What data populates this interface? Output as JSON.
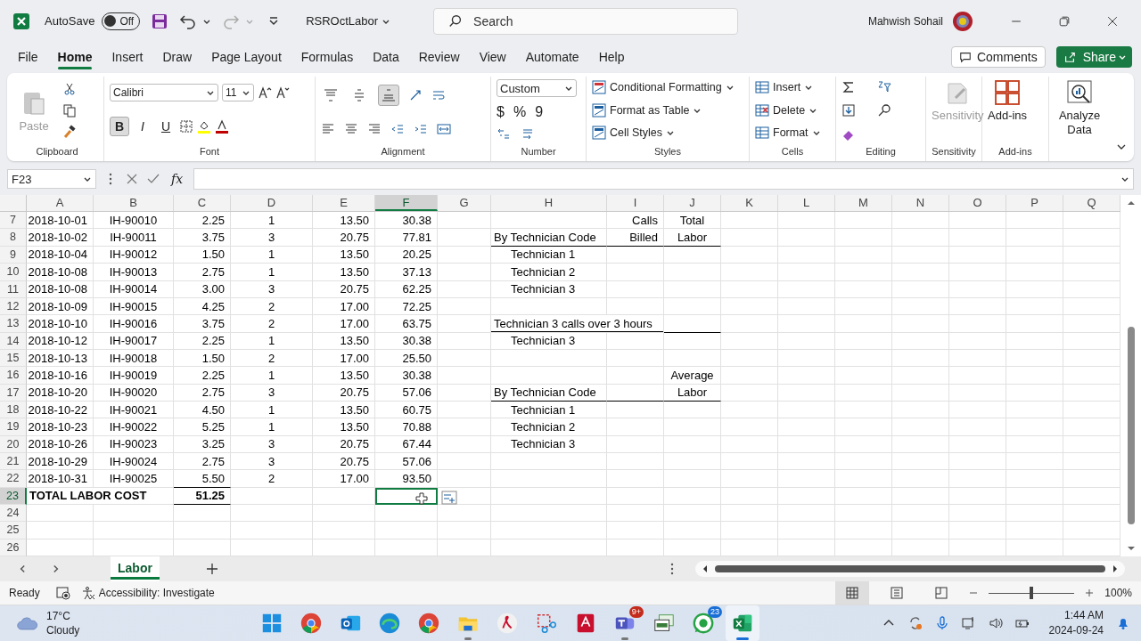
{
  "title_bar": {
    "autosave_label": "AutoSave",
    "autosave": {
      "label": "Off",
      "on": false
    },
    "file_name": "RSROctLabor",
    "search_placeholder": "Search",
    "user_name": "Mahwish Sohail"
  },
  "menu_tabs": [
    {
      "label": "File",
      "selected": false
    },
    {
      "label": "Home",
      "selected": true
    },
    {
      "label": "Insert",
      "selected": false
    },
    {
      "label": "Draw",
      "selected": false
    },
    {
      "label": "Page Layout",
      "selected": false
    },
    {
      "label": "Formulas",
      "selected": false
    },
    {
      "label": "Data",
      "selected": false
    },
    {
      "label": "Review",
      "selected": false
    },
    {
      "label": "View",
      "selected": false
    },
    {
      "label": "Automate",
      "selected": false
    },
    {
      "label": "Help",
      "selected": false
    }
  ],
  "comments_button": "Comments",
  "share_button": "Share",
  "ribbon": {
    "clipboard": {
      "paste": "Paste",
      "paste_disabled": true,
      "label": "Clipboard"
    },
    "font": {
      "name": "Calibri",
      "size": "11",
      "label": "Font",
      "styles": [
        {
          "label": "B",
          "selected": true
        },
        {
          "label": "I",
          "selected": false
        },
        {
          "label": "U",
          "selected": false
        }
      ]
    },
    "alignment": {
      "label": "Alignment",
      "vertical": [
        {
          "selected": false
        },
        {
          "selected": false
        },
        {
          "selected": true
        }
      ]
    },
    "number": {
      "format": "Custom",
      "symbols": [
        "$",
        "%",
        "9"
      ],
      "label": "Number"
    },
    "styles": {
      "commands": [
        "Conditional Formatting",
        "Format as Table",
        "Cell Styles"
      ],
      "label": "Styles"
    },
    "cells": {
      "commands": [
        "Insert",
        "Delete",
        "Format"
      ],
      "label": "Cells"
    },
    "editing": {
      "label": "Editing"
    },
    "sensitivity": {
      "button": "Sensitivity",
      "disabled": true,
      "label": "Sensitivity"
    },
    "addins": {
      "button": "Add-ins",
      "label": "Add-ins"
    },
    "analyze": {
      "button": "Analyze Data"
    }
  },
  "formula_bar": {
    "name_box": "F23",
    "function_label": "fx"
  },
  "sheet": {
    "columns": [
      {
        "letter": "A",
        "selected": false
      },
      {
        "letter": "B",
        "selected": false
      },
      {
        "letter": "C",
        "selected": false
      },
      {
        "letter": "D",
        "selected": false
      },
      {
        "letter": "E",
        "selected": false
      },
      {
        "letter": "F",
        "selected": true
      },
      {
        "letter": "G",
        "selected": false
      },
      {
        "letter": "H",
        "selected": false
      },
      {
        "letter": "I",
        "selected": false
      },
      {
        "letter": "J",
        "selected": false
      },
      {
        "letter": "K",
        "selected": false
      },
      {
        "letter": "L",
        "selected": false
      },
      {
        "letter": "M",
        "selected": false
      },
      {
        "letter": "N",
        "selected": false
      },
      {
        "letter": "O",
        "selected": false
      },
      {
        "letter": "P",
        "selected": false
      },
      {
        "letter": "Q",
        "selected": false
      }
    ],
    "rows": [
      {
        "number": "7",
        "selected": false,
        "cells": [
          {
            "kind": "date",
            "text": "2018-10-01"
          },
          {
            "kind": "code",
            "text": "IH-90010"
          },
          {
            "kind": "amount",
            "text": "2.25"
          },
          {
            "kind": "count",
            "text": "1"
          },
          {
            "kind": "amount",
            "text": "13.50"
          },
          {
            "kind": "amount",
            "text": "30.38"
          },
          {
            "kind": "blank"
          },
          {
            "kind": "blank"
          },
          {
            "kind": "header-right",
            "text": "Calls"
          },
          {
            "kind": "header-center",
            "text": "Total"
          }
        ]
      },
      {
        "number": "8",
        "selected": false,
        "cells": [
          {
            "kind": "date",
            "text": "2018-10-02"
          },
          {
            "kind": "code",
            "text": "IH-90011"
          },
          {
            "kind": "amount",
            "text": "3.75"
          },
          {
            "kind": "count",
            "text": "3"
          },
          {
            "kind": "amount",
            "text": "20.75"
          },
          {
            "kind": "amount",
            "text": "77.81"
          },
          {
            "kind": "blank"
          },
          {
            "kind": "heading",
            "text": "By Technician Code",
            "underline": true
          },
          {
            "kind": "header-right",
            "text": "Billed",
            "underline": true
          },
          {
            "kind": "header-center",
            "text": "Labor",
            "underline": true
          }
        ]
      },
      {
        "number": "9",
        "selected": false,
        "cells": [
          {
            "kind": "date",
            "text": "2018-10-04"
          },
          {
            "kind": "code",
            "text": "IH-90012"
          },
          {
            "kind": "amount",
            "text": "1.50"
          },
          {
            "kind": "count",
            "text": "1"
          },
          {
            "kind": "amount",
            "text": "13.50"
          },
          {
            "kind": "amount",
            "text": "20.25"
          },
          {
            "kind": "blank"
          },
          {
            "kind": "indented",
            "text": "Technician 1"
          }
        ]
      },
      {
        "number": "10",
        "selected": false,
        "cells": [
          {
            "kind": "date",
            "text": "2018-10-08"
          },
          {
            "kind": "code",
            "text": "IH-90013"
          },
          {
            "kind": "amount",
            "text": "2.75"
          },
          {
            "kind": "count",
            "text": "1"
          },
          {
            "kind": "amount",
            "text": "13.50"
          },
          {
            "kind": "amount",
            "text": "37.13"
          },
          {
            "kind": "blank"
          },
          {
            "kind": "indented",
            "text": "Technician 2"
          }
        ]
      },
      {
        "number": "11",
        "selected": false,
        "cells": [
          {
            "kind": "date",
            "text": "2018-10-08"
          },
          {
            "kind": "code",
            "text": "IH-90014"
          },
          {
            "kind": "amount",
            "text": "3.00"
          },
          {
            "kind": "count",
            "text": "3"
          },
          {
            "kind": "amount",
            "text": "20.75"
          },
          {
            "kind": "amount",
            "text": "62.25"
          },
          {
            "kind": "blank"
          },
          {
            "kind": "indented",
            "text": "Technician 3"
          }
        ]
      },
      {
        "number": "12",
        "selected": false,
        "cells": [
          {
            "kind": "date",
            "text": "2018-10-09"
          },
          {
            "kind": "code",
            "text": "IH-90015"
          },
          {
            "kind": "amount",
            "text": "4.25"
          },
          {
            "kind": "count",
            "text": "2"
          },
          {
            "kind": "amount",
            "text": "17.00"
          },
          {
            "kind": "amount",
            "text": "72.25"
          }
        ]
      },
      {
        "number": "13",
        "selected": false,
        "cells": [
          {
            "kind": "date",
            "text": "2018-10-10"
          },
          {
            "kind": "code",
            "text": "IH-90016"
          },
          {
            "kind": "amount",
            "text": "3.75"
          },
          {
            "kind": "count",
            "text": "2"
          },
          {
            "kind": "amount",
            "text": "17.00"
          },
          {
            "kind": "amount",
            "text": "63.75"
          },
          {
            "kind": "blank"
          },
          {
            "kind": "heading",
            "text": "Technician 3 calls over 3 hours",
            "underline": true,
            "overflow": true
          },
          {
            "kind": "blank",
            "underline": true
          },
          {
            "kind": "blank",
            "underline": true
          }
        ]
      },
      {
        "number": "14",
        "selected": false,
        "cells": [
          {
            "kind": "date",
            "text": "2018-10-12"
          },
          {
            "kind": "code",
            "text": "IH-90017"
          },
          {
            "kind": "amount",
            "text": "2.25"
          },
          {
            "kind": "count",
            "text": "1"
          },
          {
            "kind": "amount",
            "text": "13.50"
          },
          {
            "kind": "amount",
            "text": "30.38"
          },
          {
            "kind": "blank"
          },
          {
            "kind": "indented",
            "text": "Technician 3"
          }
        ]
      },
      {
        "number": "15",
        "selected": false,
        "cells": [
          {
            "kind": "date",
            "text": "2018-10-13"
          },
          {
            "kind": "code",
            "text": "IH-90018"
          },
          {
            "kind": "amount",
            "text": "1.50"
          },
          {
            "kind": "count",
            "text": "2"
          },
          {
            "kind": "amount",
            "text": "17.00"
          },
          {
            "kind": "amount",
            "text": "25.50"
          }
        ]
      },
      {
        "number": "16",
        "selected": false,
        "cells": [
          {
            "kind": "date",
            "text": "2018-10-16"
          },
          {
            "kind": "code",
            "text": "IH-90019"
          },
          {
            "kind": "amount",
            "text": "2.25"
          },
          {
            "kind": "count",
            "text": "1"
          },
          {
            "kind": "amount",
            "text": "13.50"
          },
          {
            "kind": "amount",
            "text": "30.38"
          },
          {
            "kind": "blank"
          },
          {
            "kind": "blank"
          },
          {
            "kind": "blank"
          },
          {
            "kind": "header-center",
            "text": "Average"
          }
        ]
      },
      {
        "number": "17",
        "selected": false,
        "cells": [
          {
            "kind": "date",
            "text": "2018-10-20"
          },
          {
            "kind": "code",
            "text": "IH-90020"
          },
          {
            "kind": "amount",
            "text": "2.75"
          },
          {
            "kind": "count",
            "text": "3"
          },
          {
            "kind": "amount",
            "text": "20.75"
          },
          {
            "kind": "amount",
            "text": "57.06"
          },
          {
            "kind": "blank"
          },
          {
            "kind": "heading",
            "text": "By Technician Code",
            "underline": true
          },
          {
            "kind": "blank",
            "underline": true
          },
          {
            "kind": "header-center",
            "text": "Labor",
            "underline": true
          }
        ]
      },
      {
        "number": "18",
        "selected": false,
        "cells": [
          {
            "kind": "date",
            "text": "2018-10-22"
          },
          {
            "kind": "code",
            "text": "IH-90021"
          },
          {
            "kind": "amount",
            "text": "4.50"
          },
          {
            "kind": "count",
            "text": "1"
          },
          {
            "kind": "amount",
            "text": "13.50"
          },
          {
            "kind": "amount",
            "text": "60.75"
          },
          {
            "kind": "blank"
          },
          {
            "kind": "indented",
            "text": "Technician 1"
          }
        ]
      },
      {
        "number": "19",
        "selected": false,
        "cells": [
          {
            "kind": "date",
            "text": "2018-10-23"
          },
          {
            "kind": "code",
            "text": "IH-90022"
          },
          {
            "kind": "amount",
            "text": "5.25"
          },
          {
            "kind": "count",
            "text": "1"
          },
          {
            "kind": "amount",
            "text": "13.50"
          },
          {
            "kind": "amount",
            "text": "70.88"
          },
          {
            "kind": "blank"
          },
          {
            "kind": "indented",
            "text": "Technician 2"
          }
        ]
      },
      {
        "number": "20",
        "selected": false,
        "cells": [
          {
            "kind": "date",
            "text": "2018-10-26"
          },
          {
            "kind": "code",
            "text": "IH-90023"
          },
          {
            "kind": "amount",
            "text": "3.25"
          },
          {
            "kind": "count",
            "text": "3"
          },
          {
            "kind": "amount",
            "text": "20.75"
          },
          {
            "kind": "amount",
            "text": "67.44"
          },
          {
            "kind": "blank"
          },
          {
            "kind": "indented",
            "text": "Technician 3"
          }
        ]
      },
      {
        "number": "21",
        "selected": false,
        "cells": [
          {
            "kind": "date",
            "text": "2018-10-29"
          },
          {
            "kind": "code",
            "text": "IH-90024"
          },
          {
            "kind": "amount",
            "text": "2.75"
          },
          {
            "kind": "count",
            "text": "3"
          },
          {
            "kind": "amount",
            "text": "20.75"
          },
          {
            "kind": "amount",
            "text": "57.06"
          }
        ]
      },
      {
        "number": "22",
        "selected": false,
        "cells": [
          {
            "kind": "date",
            "text": "2018-10-31"
          },
          {
            "kind": "code",
            "text": "IH-90025"
          },
          {
            "kind": "amount",
            "text": "5.50",
            "underline": true
          },
          {
            "kind": "count",
            "text": "2"
          },
          {
            "kind": "amount",
            "text": "17.00"
          },
          {
            "kind": "amount",
            "text": "93.50"
          }
        ]
      },
      {
        "number": "23",
        "selected": true,
        "cells": [
          {
            "kind": "total",
            "text": "TOTAL LABOR COST",
            "overflow": true
          },
          {
            "kind": "blank"
          },
          {
            "kind": "total-amount",
            "text": "51.25",
            "underline": true
          },
          {
            "kind": "blank"
          },
          {
            "kind": "blank"
          },
          {
            "kind": "blank",
            "active": true
          }
        ]
      },
      {
        "number": "24",
        "selected": false
      },
      {
        "number": "25",
        "selected": false
      },
      {
        "number": "26",
        "selected": false
      }
    ]
  },
  "sheet_tabs": [
    {
      "label": "Labor",
      "selected": true
    }
  ],
  "status_bar": {
    "status": "Ready",
    "accessibility": "Accessibility: Investigate",
    "views": [
      {
        "kind": "normal",
        "selected": true
      },
      {
        "kind": "page-layout",
        "selected": false
      },
      {
        "kind": "page-break",
        "selected": false
      }
    ],
    "zoom": {
      "level": 0.5,
      "reading": "100%"
    }
  },
  "taskbar": {
    "weather": {
      "temperature": "17°C",
      "condition": "Cloudy"
    },
    "apps": [
      {
        "kind": "start",
        "running": false,
        "active": false
      },
      {
        "kind": "chrome",
        "running": false,
        "active": false
      },
      {
        "kind": "outlook",
        "running": false,
        "active": false
      },
      {
        "kind": "edge",
        "running": false,
        "active": false
      },
      {
        "kind": "chrome",
        "running": false,
        "active": false
      },
      {
        "kind": "folder",
        "running": true,
        "active": false
      },
      {
        "kind": "reader",
        "running": false,
        "active": false
      },
      {
        "kind": "snip",
        "running": false,
        "active": false
      },
      {
        "kind": "cad",
        "running": false,
        "active": false
      },
      {
        "kind": "teams",
        "running": true,
        "active": false,
        "badge": "9+"
      },
      {
        "kind": "slides",
        "running": false,
        "active": false
      },
      {
        "kind": "whatsapp",
        "running": false,
        "active": false,
        "badge": "23"
      },
      {
        "kind": "excel",
        "running": true,
        "active": true
      }
    ],
    "time": "1:44 AM",
    "date": "2024-09-24"
  }
}
